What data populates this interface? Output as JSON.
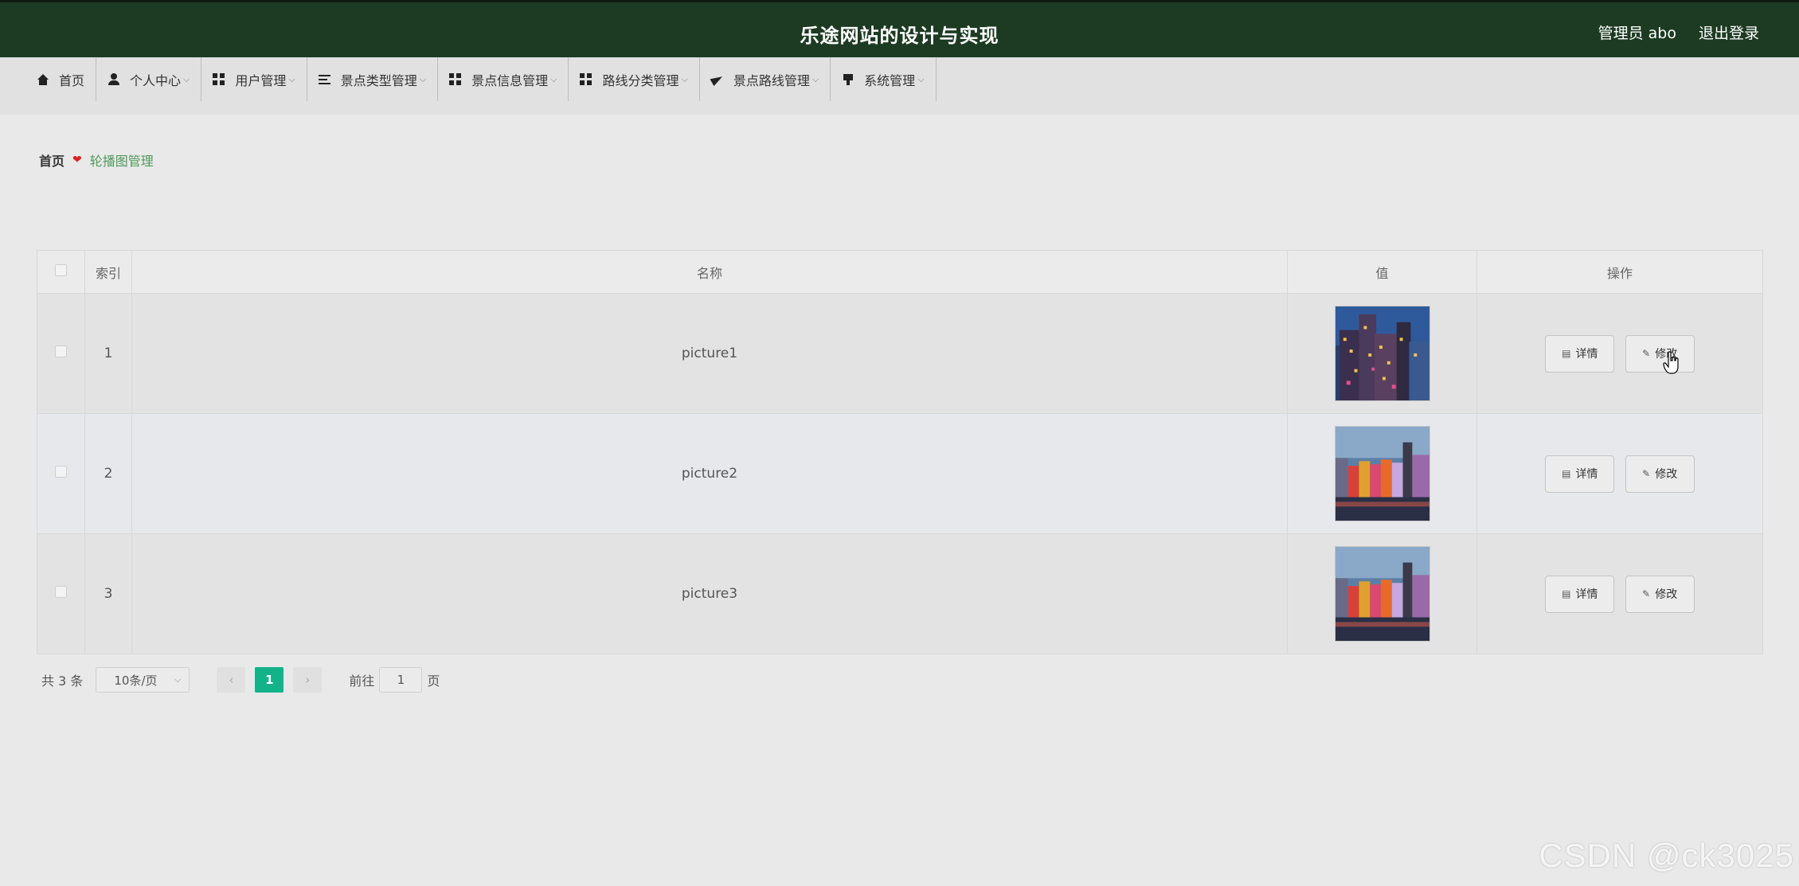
{
  "header": {
    "title": "乐途网站的设计与实现",
    "user_label": "管理员 abo",
    "logout_label": "退出登录"
  },
  "nav": {
    "items": [
      {
        "label": "首页",
        "icon": "home-icon",
        "has_dropdown": false
      },
      {
        "label": "个人中心",
        "icon": "user-icon",
        "has_dropdown": true
      },
      {
        "label": "用户管理",
        "icon": "grid-icon",
        "has_dropdown": true
      },
      {
        "label": "景点类型管理",
        "icon": "list-icon",
        "has_dropdown": true
      },
      {
        "label": "景点信息管理",
        "icon": "grid-icon",
        "has_dropdown": true
      },
      {
        "label": "路线分类管理",
        "icon": "grid-icon",
        "has_dropdown": true
      },
      {
        "label": "景点路线管理",
        "icon": "send-icon",
        "has_dropdown": true
      },
      {
        "label": "系统管理",
        "icon": "pin-icon",
        "has_dropdown": true
      }
    ]
  },
  "breadcrumb": {
    "home": "首页",
    "current": "轮播图管理"
  },
  "table": {
    "headers": {
      "index": "索引",
      "name": "名称",
      "value": "值",
      "actions": "操作"
    },
    "rows": [
      {
        "index": "1",
        "name": "picture1",
        "image": "night-city-photo"
      },
      {
        "index": "2",
        "name": "picture2",
        "image": "colorful-waterfront-photo"
      },
      {
        "index": "3",
        "name": "picture3",
        "image": "colorful-waterfront-photo"
      }
    ],
    "detail_label": "详情",
    "edit_label": "修改"
  },
  "pagination": {
    "total_text": "共 3 条",
    "page_size": "10条/页",
    "current_page": "1",
    "goto_prefix": "前往",
    "goto_value": "1",
    "goto_suffix": "页"
  },
  "watermark": "CSDN @ck3025",
  "colors": {
    "header_bg": "#1d3b23",
    "accent": "#13b38a",
    "breadcrumb_current": "#4f9a5b",
    "heart": "#e02020"
  }
}
